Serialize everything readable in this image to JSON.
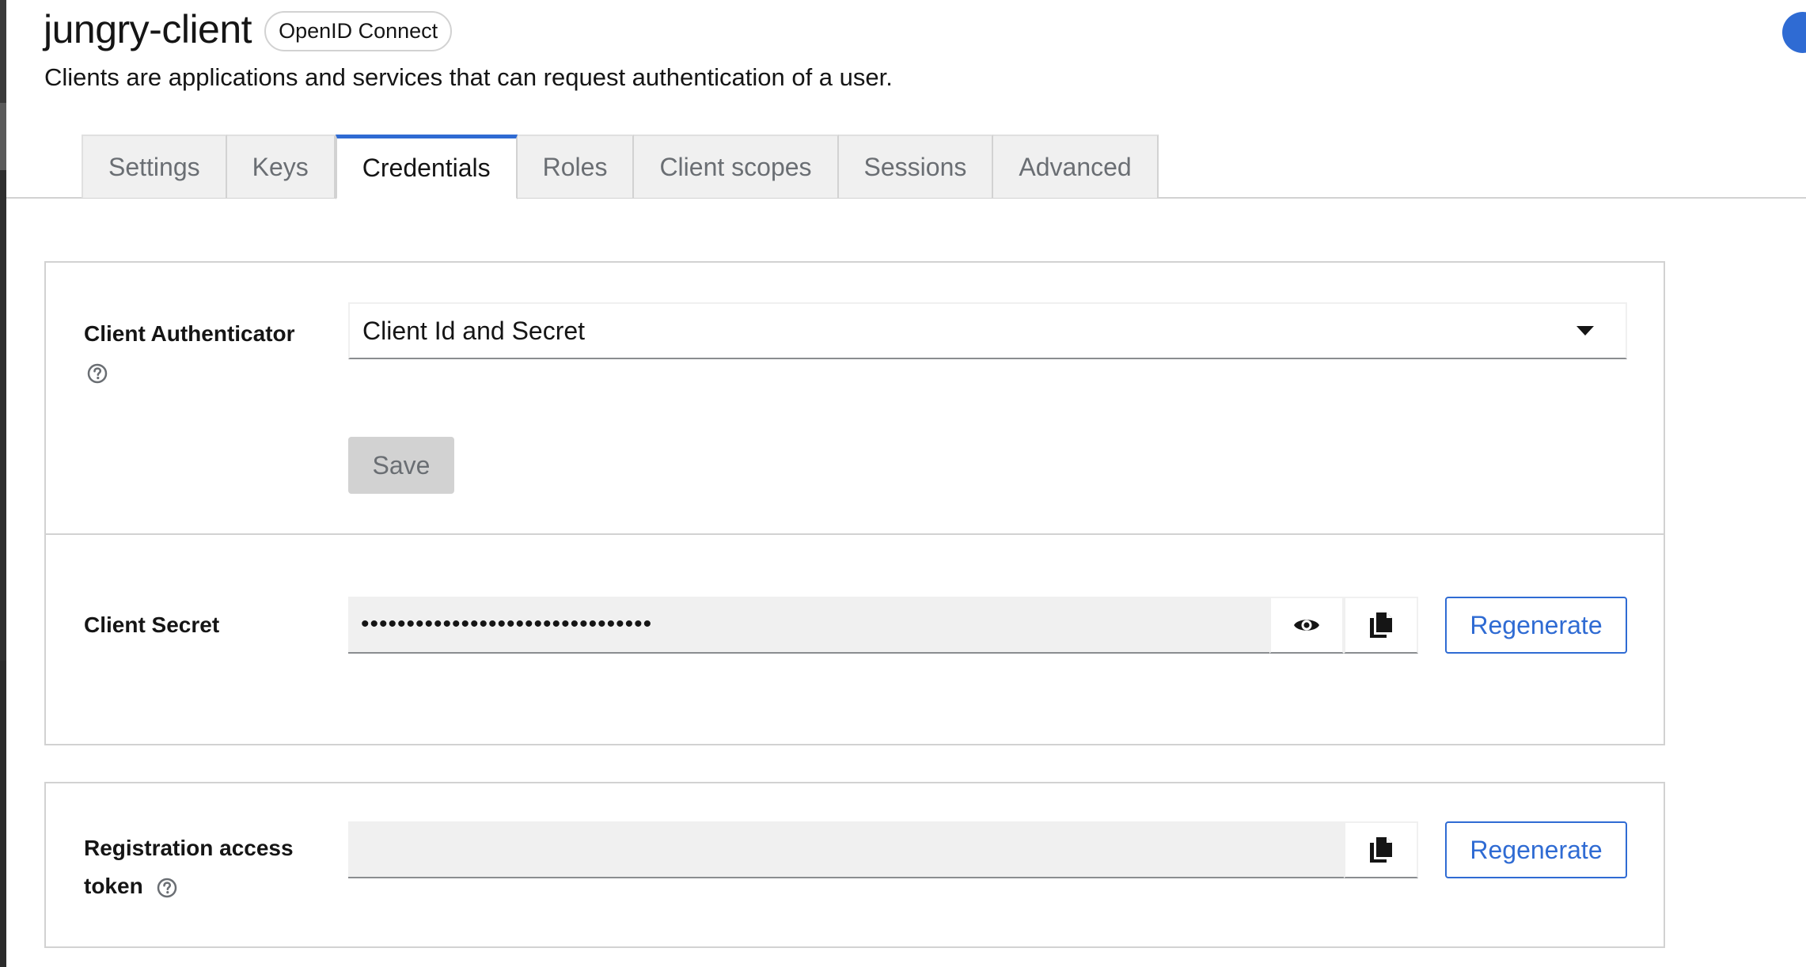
{
  "header": {
    "title": "jungry-client",
    "protocol_badge": "OpenID Connect",
    "subtitle": "Clients are applications and services that can request authentication of a user."
  },
  "tabs": [
    {
      "label": "Settings",
      "active": false
    },
    {
      "label": "Keys",
      "active": false
    },
    {
      "label": "Credentials",
      "active": true
    },
    {
      "label": "Roles",
      "active": false
    },
    {
      "label": "Client scopes",
      "active": false
    },
    {
      "label": "Sessions",
      "active": false
    },
    {
      "label": "Advanced",
      "active": false
    }
  ],
  "client_authenticator": {
    "label": "Client Authenticator",
    "selected": "Client Id and Secret",
    "save_label": "Save"
  },
  "client_secret": {
    "label": "Client Secret",
    "masked_value": "••••••••••••••••••••••••••••••••",
    "regenerate_label": "Regenerate"
  },
  "registration_token": {
    "label": "Registration access token",
    "value": "",
    "regenerate_label": "Regenerate"
  },
  "colors": {
    "accent": "#2f6bd3",
    "border": "#d2d2d2",
    "input_bg": "#f0f0f0",
    "disabled_btn": "#d2d2d2"
  },
  "icons": {
    "help": "help-circle-icon",
    "caret": "caret-down-icon",
    "eye": "eye-icon",
    "copy": "copy-icon"
  }
}
